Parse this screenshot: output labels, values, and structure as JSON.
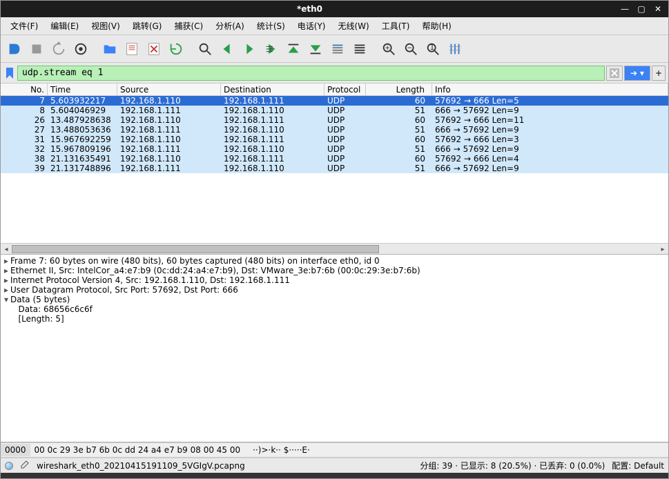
{
  "window": {
    "title": "*eth0"
  },
  "menu": {
    "file": "文件(F)",
    "edit": "编辑(E)",
    "view": "视图(V)",
    "go": "跳转(G)",
    "capture": "捕获(C)",
    "analyze": "分析(A)",
    "stats": "统计(S)",
    "telephony": "电话(Y)",
    "wireless": "无线(W)",
    "tools": "工具(T)",
    "help": "帮助(H)"
  },
  "filter": {
    "value": "udp.stream eq 1",
    "plus": "+"
  },
  "columns": {
    "no": "No.",
    "time": "Time",
    "source": "Source",
    "destination": "Destination",
    "protocol": "Protocol",
    "length": "Length",
    "info": "Info"
  },
  "packets": [
    {
      "no": "7",
      "time": "5.603932217",
      "src": "192.168.1.110",
      "dst": "192.168.1.111",
      "proto": "UDP",
      "len": "60",
      "info": "57692 → 666 Len=5",
      "selected": true
    },
    {
      "no": "8",
      "time": "5.604046929",
      "src": "192.168.1.111",
      "dst": "192.168.1.110",
      "proto": "UDP",
      "len": "51",
      "info": "666 → 57692 Len=9"
    },
    {
      "no": "26",
      "time": "13.487928638",
      "src": "192.168.1.110",
      "dst": "192.168.1.111",
      "proto": "UDP",
      "len": "60",
      "info": "57692 → 666 Len=11"
    },
    {
      "no": "27",
      "time": "13.488053636",
      "src": "192.168.1.111",
      "dst": "192.168.1.110",
      "proto": "UDP",
      "len": "51",
      "info": "666 → 57692 Len=9"
    },
    {
      "no": "31",
      "time": "15.967692259",
      "src": "192.168.1.110",
      "dst": "192.168.1.111",
      "proto": "UDP",
      "len": "60",
      "info": "57692 → 666 Len=3"
    },
    {
      "no": "32",
      "time": "15.967809196",
      "src": "192.168.1.111",
      "dst": "192.168.1.110",
      "proto": "UDP",
      "len": "51",
      "info": "666 → 57692 Len=9"
    },
    {
      "no": "38",
      "time": "21.131635491",
      "src": "192.168.1.110",
      "dst": "192.168.1.111",
      "proto": "UDP",
      "len": "60",
      "info": "57692 → 666 Len=4"
    },
    {
      "no": "39",
      "time": "21.131748896",
      "src": "192.168.1.111",
      "dst": "192.168.1.110",
      "proto": "UDP",
      "len": "51",
      "info": "666 → 57692 Len=9"
    }
  ],
  "details": {
    "l0": "Frame 7: 60 bytes on wire (480 bits), 60 bytes captured (480 bits) on interface eth0, id 0",
    "l1": "Ethernet II, Src: IntelCor_a4:e7:b9 (0c:dd:24:a4:e7:b9), Dst: VMware_3e:b7:6b (00:0c:29:3e:b7:6b)",
    "l2": "Internet Protocol Version 4, Src: 192.168.1.110, Dst: 192.168.1.111",
    "l3": "User Datagram Protocol, Src Port: 57692, Dst Port: 666",
    "l4": "Data (5 bytes)",
    "l5": "Data: 68656c6c6f",
    "l6": "[Length: 5]"
  },
  "hex": {
    "offset": "0000",
    "bytes": "00 0c 29 3e b7 6b 0c dd  24 a4 e7 b9 08 00 45 00",
    "ascii": "··)>·k·· $·····E·"
  },
  "status": {
    "filename": "wireshark_eth0_20210415191109_5VGIgV.pcapng",
    "pkts": "分组: 39 · 已显示: 8 (20.5%) · 已丢弃: 0 (0.0%)",
    "profile": "配置: Default"
  }
}
